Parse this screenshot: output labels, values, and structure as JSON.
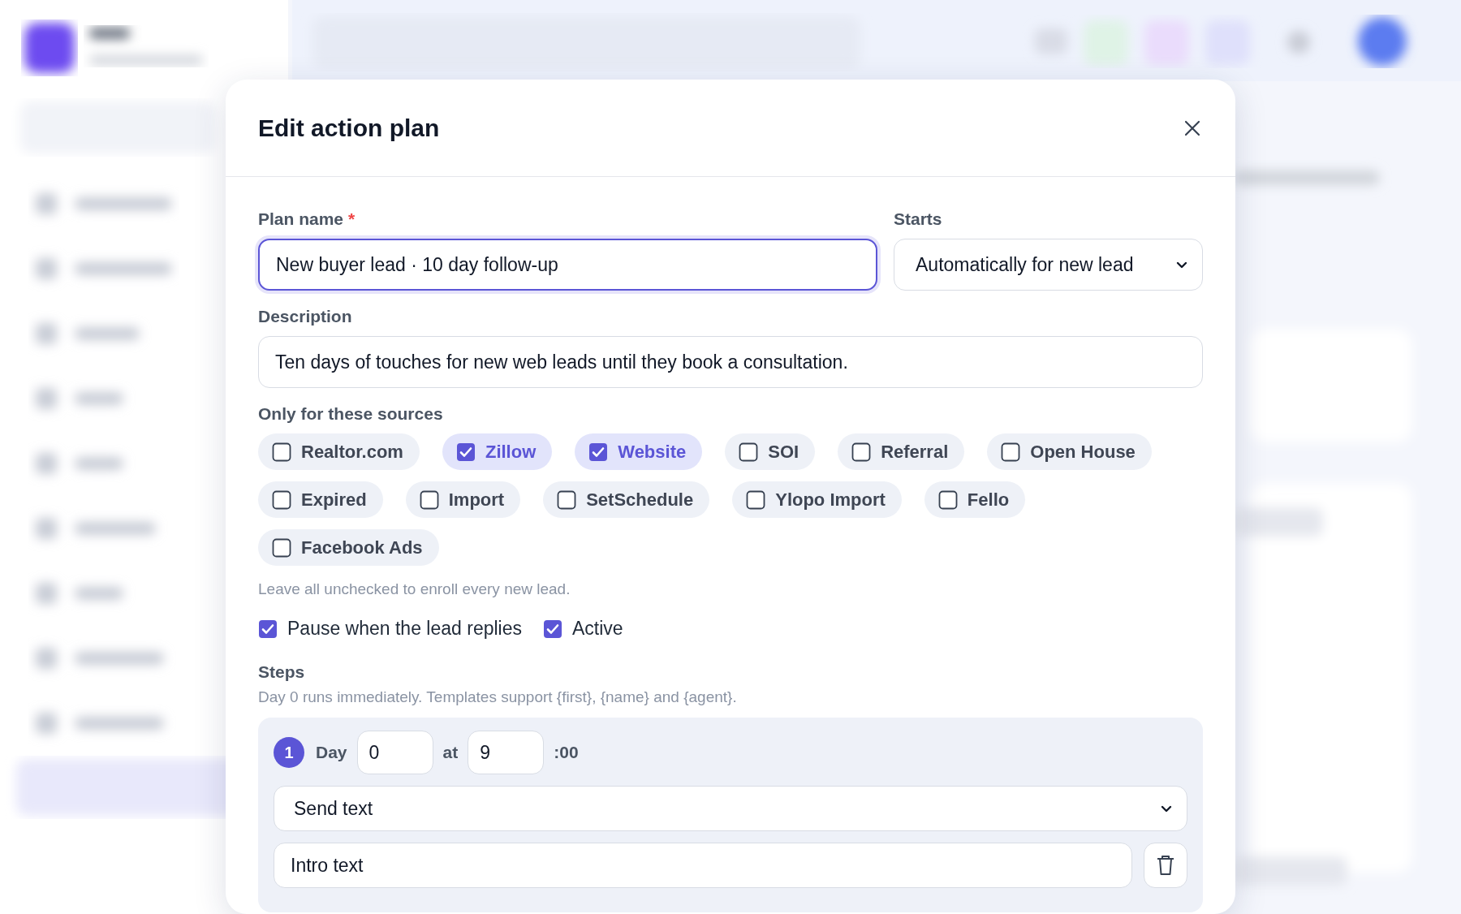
{
  "modal": {
    "title": "Edit action plan",
    "plan_name": {
      "label": "Plan name",
      "required_mark": "*",
      "value": "New buyer lead · 10 day follow-up",
      "focused": true
    },
    "starts": {
      "label": "Starts",
      "value": "Automatically for new lead"
    },
    "description": {
      "label": "Description",
      "value": "Ten days of touches for new web leads until they book a consultation."
    },
    "sources": {
      "label": "Only for these sources",
      "items": [
        {
          "label": "Realtor.com",
          "checked": false
        },
        {
          "label": "Zillow",
          "checked": true
        },
        {
          "label": "Website",
          "checked": true
        },
        {
          "label": "SOI",
          "checked": false
        },
        {
          "label": "Referral",
          "checked": false
        },
        {
          "label": "Open House",
          "checked": false
        },
        {
          "label": "Expired",
          "checked": false
        },
        {
          "label": "Import",
          "checked": false
        },
        {
          "label": "SetSchedule",
          "checked": false
        },
        {
          "label": "Ylopo Import",
          "checked": false
        },
        {
          "label": "Fello",
          "checked": false
        },
        {
          "label": "Facebook Ads",
          "checked": false
        }
      ],
      "hint": "Leave all unchecked to enroll every new lead."
    },
    "options": [
      {
        "label": "Pause when the lead replies",
        "checked": true
      },
      {
        "label": "Active",
        "checked": true
      }
    ],
    "steps": {
      "label": "Steps",
      "hint": "Day 0 runs immediately. Templates support {first}, {name} and {agent}.",
      "items": [
        {
          "number": "1",
          "day_label": "Day",
          "day": "0",
          "at_label": "at",
          "hour": "9",
          "minutes": ":00",
          "action": "Send text",
          "name": "Intro text"
        }
      ]
    }
  }
}
